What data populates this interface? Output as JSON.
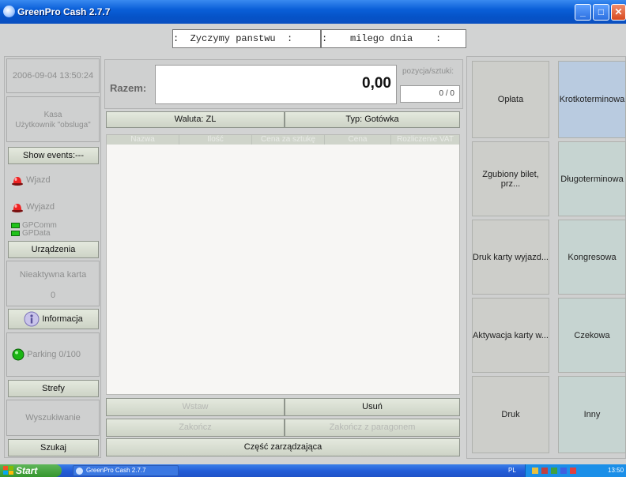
{
  "window": {
    "title": "GreenPro Cash 2.7.7"
  },
  "messages": {
    "left": ":  Zyczymy panstwu  :",
    "right": ":    milego dnia    :"
  },
  "sidebar": {
    "datetime": "2006-09-04 13:50:24",
    "kasa_label": "Kasa",
    "user_label": "Użytkownik \"obsluga\"",
    "show_events": "Show events:---",
    "entry": "Wjazd",
    "exit": "Wyjazd",
    "gpcomm": "GPComm",
    "gpdata": "GPData",
    "devices": "Urządzenia",
    "card_status": "Nieaktywna karta",
    "card_value": "0",
    "info": "Informacja",
    "parking": "Parking 0/100",
    "zones": "Strefy",
    "search_label": "Wyszukiwanie",
    "search_button": "Szukaj"
  },
  "total": {
    "label": "Razem:",
    "amount": "0,00",
    "count_label": "pozycja/sztuki:",
    "count_value": "0 / 0",
    "currency": "Waluta:  ZL",
    "payment_type": "Typ:  Gotówka"
  },
  "table": {
    "columns": [
      "Nazwa",
      "Ilość",
      "Cena za sztukę",
      "Cena",
      "Rozliczenie VAT"
    ]
  },
  "actions": {
    "insert": "Wstaw",
    "remove": "Usuń",
    "finish": "Zakończ",
    "finish_receipt": "Zakończ z paragonem",
    "management": "Część zarządzająca"
  },
  "grid": {
    "left": [
      "Opłata",
      "Zgubiony bilet, prz...",
      "Druk karty wyjazd...",
      "Aktywacja karty w...",
      "Druk"
    ],
    "right": [
      "Krotkoterminowa",
      "Długoterminowa",
      "Kongresowa",
      "Czekowa",
      "Inny"
    ]
  },
  "taskbar": {
    "start": "Start",
    "task": "GreenPro Cash 2.7.7",
    "lang": "PL",
    "clock": "13:50"
  },
  "colors": {
    "titlebar": "#0a5fd8",
    "led_green": "#1fc21a",
    "active_tariff": "#b9cbe0"
  }
}
